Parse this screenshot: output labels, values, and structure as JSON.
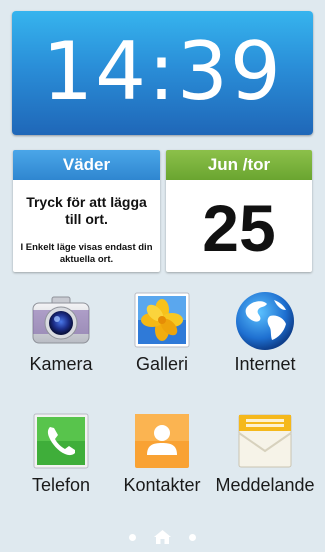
{
  "clock": {
    "time": "14:39"
  },
  "weather": {
    "header": "Väder",
    "main": "Tryck för att lägga till ort.",
    "sub": "I Enkelt läge visas endast din aktuella ort."
  },
  "calendar": {
    "header": "Jun /tor",
    "day": "25"
  },
  "apps": [
    {
      "label": "Kamera",
      "icon": "camera-icon"
    },
    {
      "label": "Galleri",
      "icon": "gallery-icon"
    },
    {
      "label": "Internet",
      "icon": "globe-icon"
    },
    {
      "label": "Telefon",
      "icon": "phone-icon"
    },
    {
      "label": "Kontakter",
      "icon": "contacts-icon"
    },
    {
      "label": "Meddelande",
      "icon": "message-icon"
    }
  ],
  "page_indicator": {
    "icons": [
      "dot",
      "home-icon",
      "dot"
    ]
  },
  "colors": {
    "clock_top": "#36b4ee",
    "clock_bottom": "#1f67b8",
    "weather_header": "#2f86d0",
    "calendar_header": "#6aa530",
    "background": "#dfe9ef"
  }
}
